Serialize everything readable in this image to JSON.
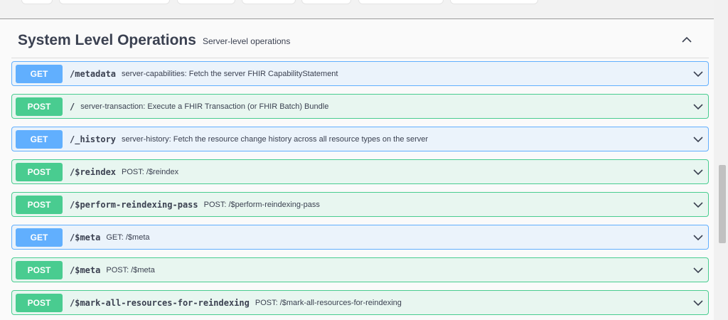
{
  "section": {
    "title": "System Level Operations",
    "description": "Server-level operations"
  },
  "icons": {
    "collapse": "chevron-up-icon",
    "expand": "chevron-down-icon"
  },
  "colors": {
    "get": "#61affe",
    "post": "#49cc90",
    "get_bg": "#ebf3fb",
    "post_bg": "#e8f6f0"
  },
  "operations": [
    {
      "method": "GET",
      "path": "/metadata",
      "summary": "server-capabilities: Fetch the server FHIR CapabilityStatement"
    },
    {
      "method": "POST",
      "path": "/",
      "summary": "server-transaction: Execute a FHIR Transaction (or FHIR Batch) Bundle"
    },
    {
      "method": "GET",
      "path": "/_history",
      "summary": "server-history: Fetch the resource change history across all resource types on the server"
    },
    {
      "method": "POST",
      "path": "/$reindex",
      "summary": "POST: /$reindex"
    },
    {
      "method": "POST",
      "path": "/$perform-reindexing-pass",
      "summary": "POST: /$perform-reindexing-pass"
    },
    {
      "method": "GET",
      "path": "/$meta",
      "summary": "GET: /$meta"
    },
    {
      "method": "POST",
      "path": "/$meta",
      "summary": "POST: /$meta"
    },
    {
      "method": "POST",
      "path": "/$mark-all-resources-for-reindexing",
      "summary": "POST: /$mark-all-resources-for-reindexing"
    }
  ]
}
